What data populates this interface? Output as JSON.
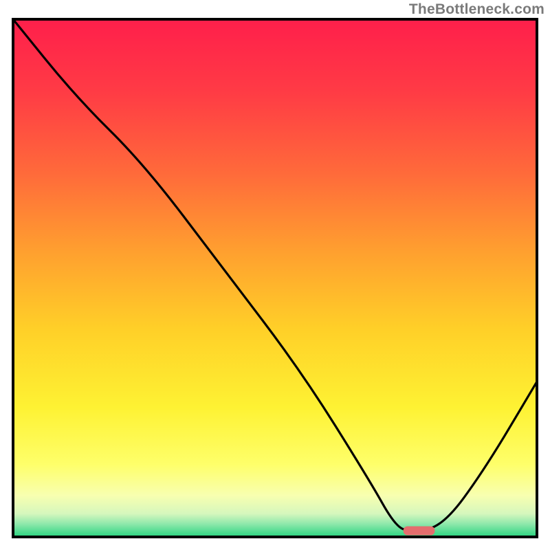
{
  "watermark": "TheBottleneck.com",
  "chart_data": {
    "type": "line",
    "title": "",
    "xlabel": "",
    "ylabel": "",
    "xlim": [
      0,
      100
    ],
    "ylim": [
      0,
      100
    ],
    "series": [
      {
        "name": "curve",
        "x": [
          0,
          12,
          25,
          40,
          55,
          68,
          73,
          76,
          82,
          90,
          100
        ],
        "values": [
          100,
          85,
          72,
          52,
          32,
          11,
          2,
          1,
          2,
          13,
          30
        ]
      }
    ],
    "marker": {
      "name": "optimal-range",
      "x_center": 77.5,
      "width": 6,
      "y": 1.2,
      "color": "#e46d6d"
    },
    "gradient_stops": [
      {
        "offset": 0.0,
        "color": "#ff1f4b"
      },
      {
        "offset": 0.14,
        "color": "#ff3b45"
      },
      {
        "offset": 0.3,
        "color": "#ff6b3a"
      },
      {
        "offset": 0.45,
        "color": "#ffa02f"
      },
      {
        "offset": 0.6,
        "color": "#ffd028"
      },
      {
        "offset": 0.75,
        "color": "#fef233"
      },
      {
        "offset": 0.86,
        "color": "#feff6a"
      },
      {
        "offset": 0.92,
        "color": "#f8ffb0"
      },
      {
        "offset": 0.955,
        "color": "#d6f7bd"
      },
      {
        "offset": 0.975,
        "color": "#8ee8ab"
      },
      {
        "offset": 1.0,
        "color": "#28d47f"
      }
    ],
    "frame_color": "#000000",
    "frame_width": 4
  }
}
